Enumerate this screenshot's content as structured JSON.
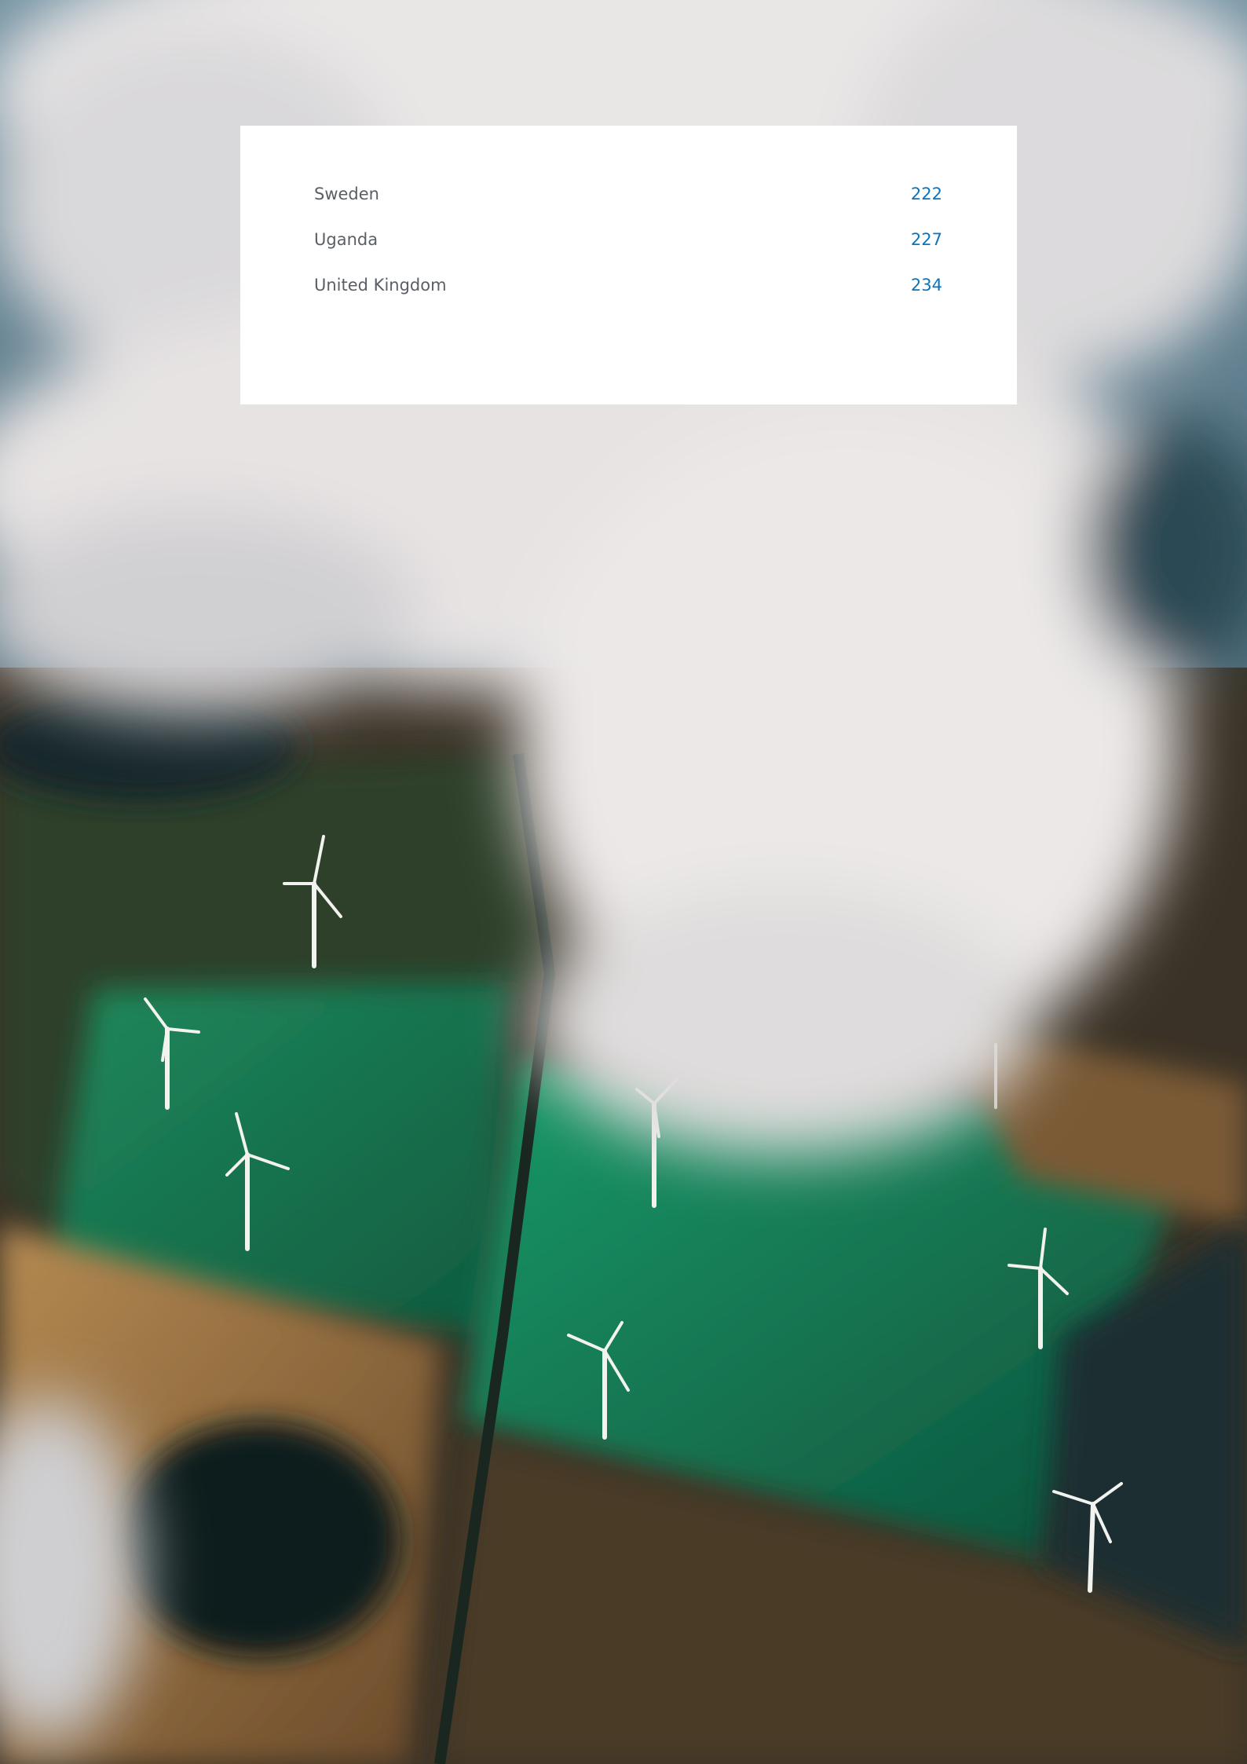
{
  "contents": {
    "entries": [
      {
        "name": "Sweden",
        "page": "222"
      },
      {
        "name": "Uganda",
        "page": "227"
      },
      {
        "name": "United Kingdom",
        "page": "234"
      }
    ]
  },
  "background": {
    "description_icon": "aerial-wind-farm-photo"
  },
  "colors": {
    "entry_text": "#5a5f66",
    "page_number": "#0a74c0",
    "panel": "#ffffff"
  }
}
